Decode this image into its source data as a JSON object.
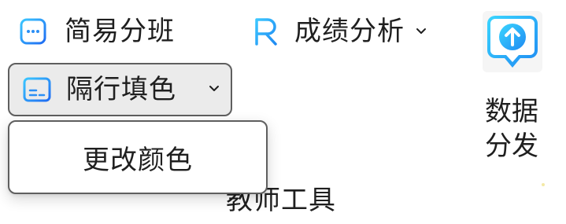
{
  "toolbar": {
    "simple_class": {
      "label": "简易分班",
      "icon": "chat-dots-icon"
    },
    "score_analysis": {
      "label": "成绩分析",
      "icon": "letter-r-icon",
      "has_dropdown": true
    },
    "alt_fill": {
      "label": "隔行填色",
      "icon": "table-stripes-icon",
      "has_dropdown": true,
      "expanded": true
    },
    "data_distribution": {
      "line1": "数据",
      "line2": "分发",
      "icon": "upload-arrow-bubble-icon"
    }
  },
  "dropdown": {
    "items": [
      {
        "label": "更改颜色"
      }
    ]
  },
  "group": {
    "label": "教师工具"
  },
  "colors": {
    "icon_gradient_start": "#3bc6ff",
    "icon_gradient_end": "#1f6cf2",
    "text": "#1f1f1f",
    "pressed_bg": "#ebebeb",
    "border": "#5f5f5f"
  }
}
